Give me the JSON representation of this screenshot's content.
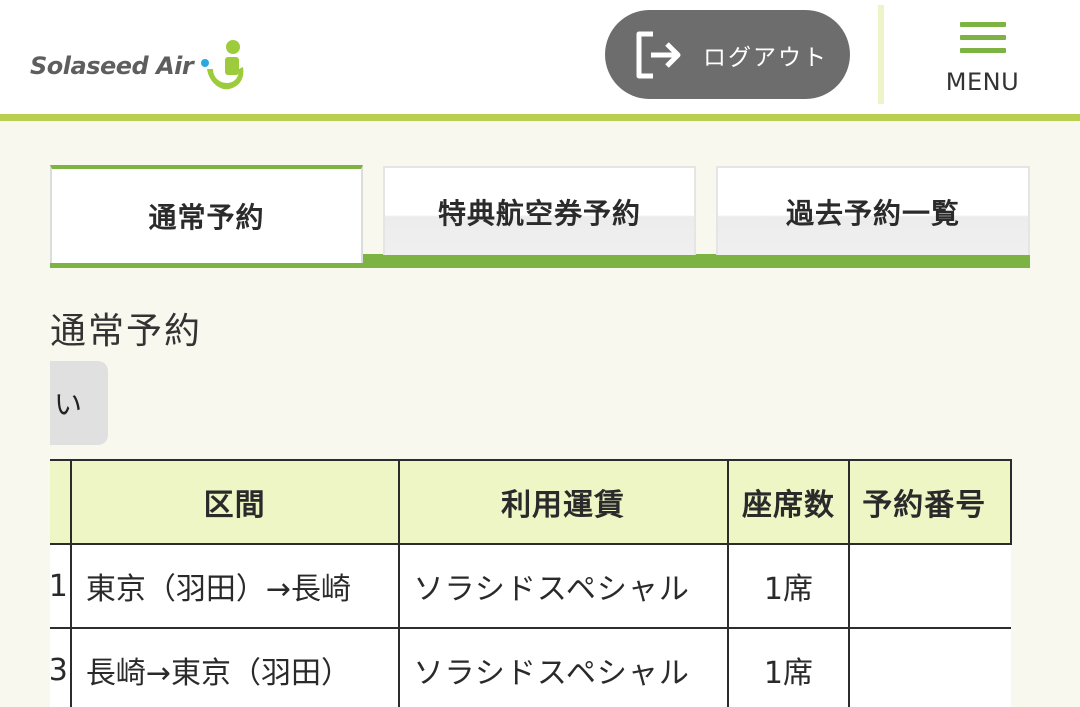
{
  "header": {
    "logo_text": "Solaseed Air",
    "logout_label": "ログアウト",
    "menu_label": "MENU"
  },
  "tabs": [
    {
      "label": "通常予約",
      "active": true
    },
    {
      "label": "特典航空券予約",
      "active": false
    },
    {
      "label": "過去予約一覧",
      "active": false
    }
  ],
  "page_title": "通常予約",
  "partial_button_label": "い",
  "table": {
    "columns": [
      "",
      "区間",
      "利用運賃",
      "座席数",
      "予約番号"
    ],
    "rows": [
      {
        "index": "1",
        "route": "東京（羽田）→長崎",
        "fare": "ソラシドスペシャル",
        "seats": "1席"
      },
      {
        "index": "3",
        "route": "長崎→東京（羽田）",
        "fare": "ソラシドスペシャル",
        "seats": "1席"
      }
    ]
  },
  "colors": {
    "accent_green": "#7cb342",
    "header_rule": "#b9cf4f",
    "logout_bg": "#6d6d6d",
    "table_header_bg": "#eff6c6"
  }
}
